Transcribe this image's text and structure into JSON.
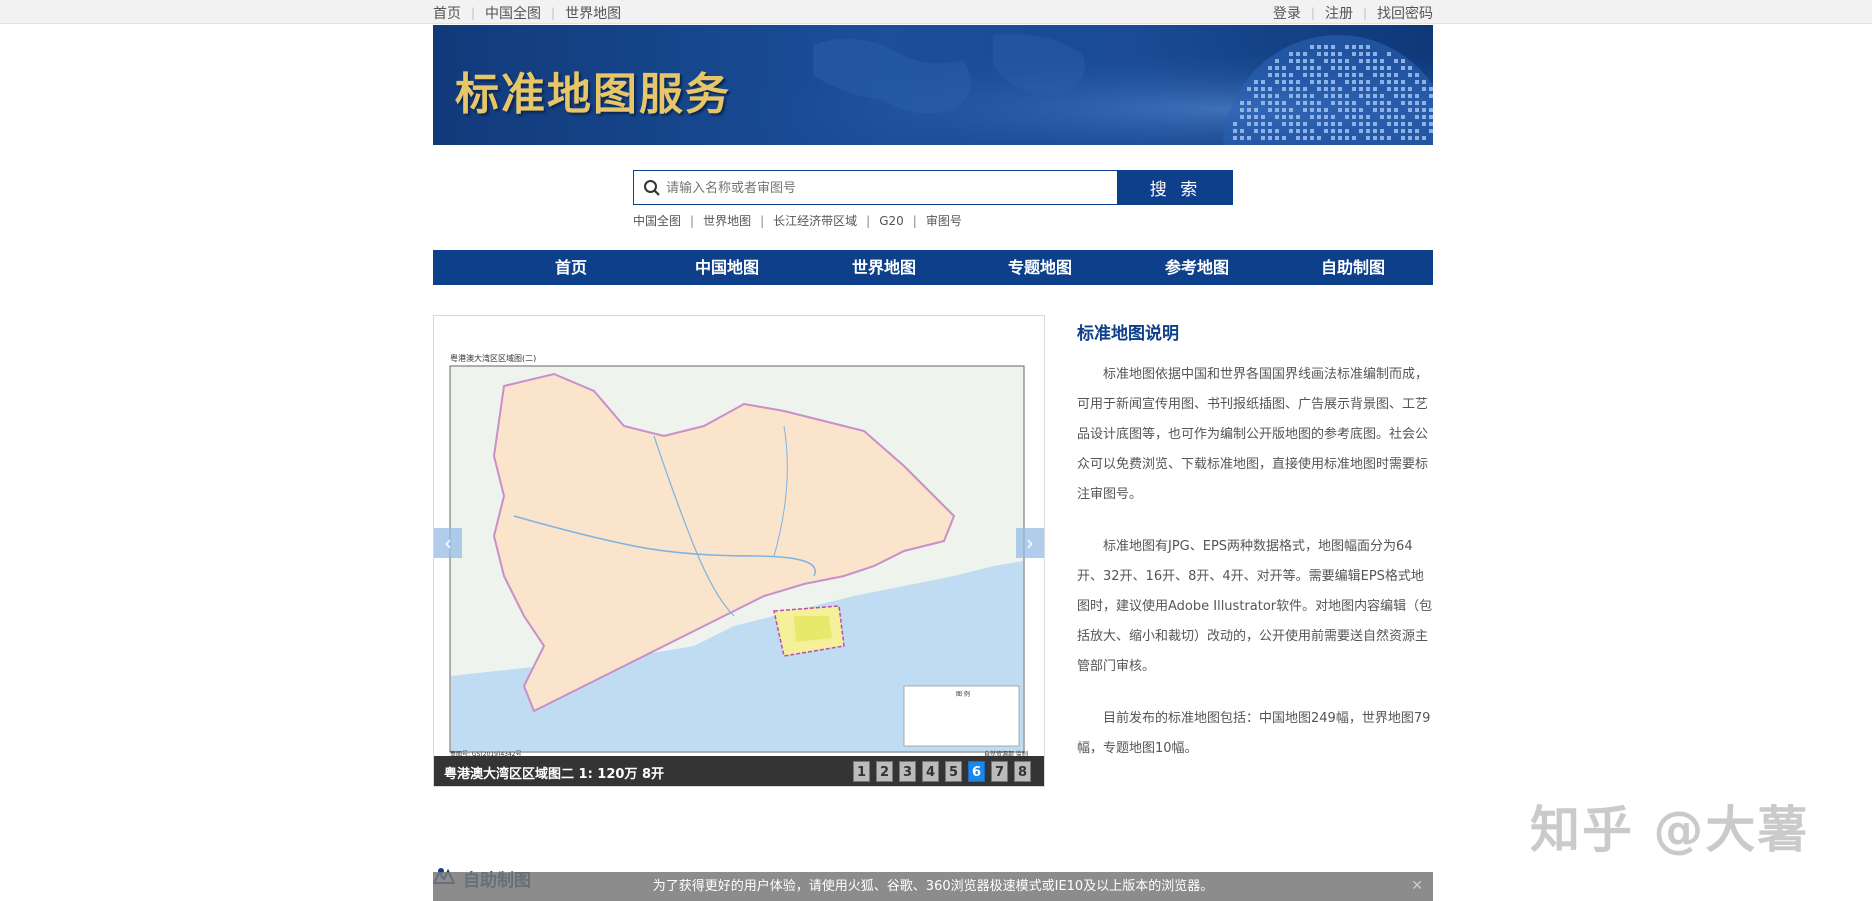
{
  "topbar": {
    "left_links": [
      "首页",
      "中国全图",
      "世界地图"
    ],
    "right_links": [
      "登录",
      "注册",
      "找回密码"
    ]
  },
  "banner": {
    "title": "标准地图服务"
  },
  "search": {
    "placeholder": "请输入名称或者审图号",
    "button_label": "搜 索",
    "quick_links": [
      "中国全图",
      "世界地图",
      "长江经济带区域",
      "G20",
      "审图号"
    ]
  },
  "nav": {
    "items": [
      "首页",
      "中国地图",
      "世界地图",
      "专题地图",
      "参考地图",
      "自助制图"
    ]
  },
  "slider": {
    "map_title": "粤港澳大湾区区域图(二)",
    "caption": "粤港澳大湾区区域图二 1: 120万 8开",
    "pages": [
      "1",
      "2",
      "3",
      "4",
      "5",
      "6",
      "7",
      "8"
    ],
    "active_page": "6",
    "legend_title": "图 例",
    "map_number": "审图号: GS(2019)4342号",
    "publisher": "自然资源部 监制"
  },
  "description": {
    "title": "标准地图说明",
    "paragraphs": [
      "标准地图依据中国和世界各国国界线画法标准编制而成，可用于新闻宣传用图、书刊报纸插图、广告展示背景图、工艺品设计底图等，也可作为编制公开版地图的参考底图。社会公众可以免费浏览、下载标准地图，直接使用标准地图时需要标注审图号。",
      "标准地图有JPG、EPS两种数据格式，地图幅面分为64开、32开、16开、8开、4开、对开等。需要编辑EPS格式地图时，建议使用Adobe Illustrator软件。对地图内容编辑（包括放大、缩小和裁切）改动的，公开使用前需要送自然资源主管部门审核。",
      "目前发布的标准地图包括：中国地图249幅，世界地图79幅，专题地图10幅。"
    ]
  },
  "bottom": {
    "section_title": "自助制图",
    "notice": "为了获得更好的用户体验，请使用火狐、谷歌、360浏览器极速模式或IE10及以上版本的浏览器。"
  },
  "watermark": "知乎 @大薯",
  "colors": {
    "primary": "#0d3f8a",
    "banner_text": "#e7c66a",
    "active_page": "#1a88e8"
  }
}
